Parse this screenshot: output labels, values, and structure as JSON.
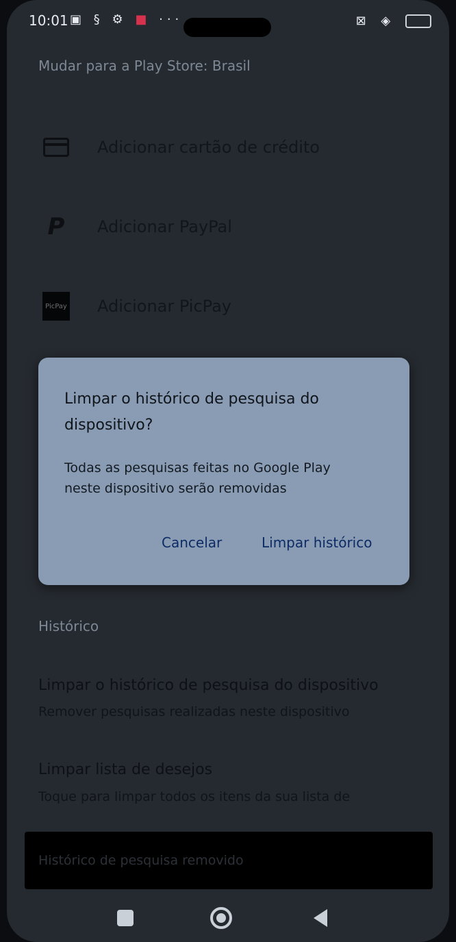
{
  "status_bar": {
    "time": "10:01",
    "left_icons": [
      "nfc-icon",
      "data-icon",
      "gear-icon",
      "notification-icon",
      "more-icon"
    ],
    "right_icons": [
      "sim-off-icon",
      "wifi-icon",
      "battery-icon"
    ]
  },
  "account": {
    "region_text": "Mudar para a Play Store: Brasil"
  },
  "payment_methods": [
    {
      "icon": "credit-card-icon",
      "label": "Adicionar cartão de crédito"
    },
    {
      "icon": "paypal-icon",
      "label": "Adicionar PayPal"
    },
    {
      "icon": "picpay-icon",
      "label": "Adicionar PicPay",
      "icon_text": "PicPay"
    }
  ],
  "history_section": {
    "title": "Histórico",
    "items": [
      {
        "title": "Limpar o histórico de pesquisa do dispositivo",
        "subtitle": "Remover pesquisas realizadas neste dispositivo"
      },
      {
        "title": "Limpar lista de desejos",
        "subtitle": "Toque para limpar todos os itens da sua lista de"
      }
    ]
  },
  "dialog": {
    "title": "Limpar o histórico de pesquisa do dispositivo?",
    "body": "Todas as pesquisas feitas no Google Play neste dispositivo serão removidas",
    "cancel_label": "Cancelar",
    "confirm_label": "Limpar histórico",
    "accent_color": "#0d2c66"
  },
  "snackbar": {
    "text": "Histórico de pesquisa removido"
  },
  "nav_bar": {
    "buttons": [
      "recent-apps-icon",
      "home-icon",
      "back-icon"
    ]
  }
}
